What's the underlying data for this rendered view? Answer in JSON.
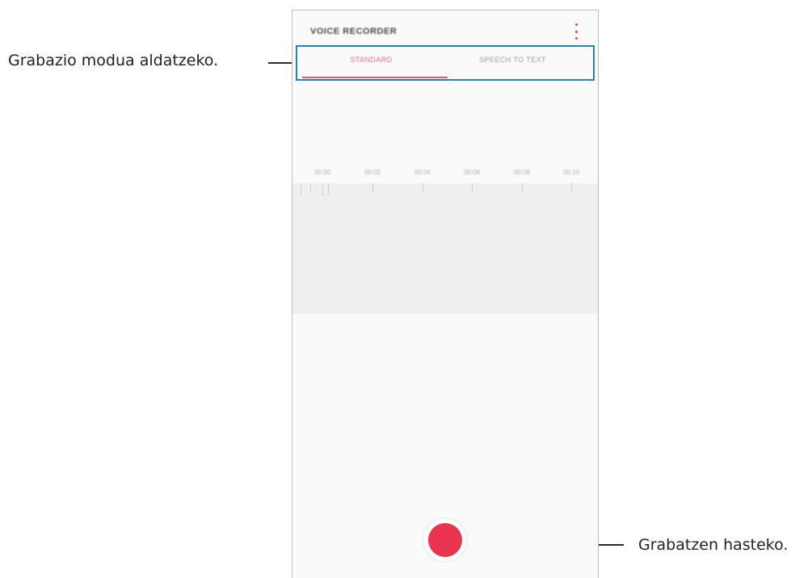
{
  "annotations": {
    "mode_label": "Grabazio modua aldatzeko.",
    "record_label": "Grabatzen hasteko."
  },
  "app": {
    "title": "VOICE RECORDER",
    "more_icon": "more-vertical-icon"
  },
  "tabs": [
    {
      "label": "STANDARD",
      "selected": true
    },
    {
      "label": "SPEECH TO TEXT",
      "selected": false
    }
  ],
  "timeline": {
    "labels": [
      "00:00",
      "00:02",
      "00:04",
      "00:06",
      "00:08",
      "00:10"
    ]
  },
  "record_button": {
    "icon": "record-icon",
    "color": "#e8344e"
  },
  "colors": {
    "accent": "#e05a74",
    "callout_border": "#2a7fb4"
  }
}
